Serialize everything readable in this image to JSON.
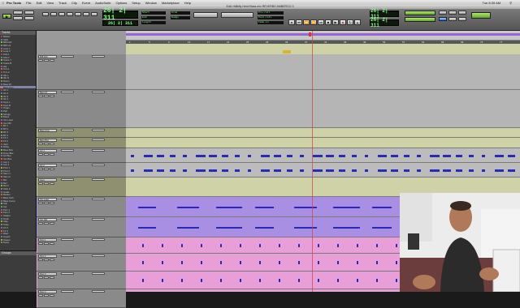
{
  "menubar": {
    "app": "Pro Tools",
    "items": [
      "File",
      "Edit",
      "View",
      "Track",
      "Clip",
      "Event",
      "AudioSuite",
      "Options",
      "Setup",
      "Window",
      "Marketplace",
      "Help"
    ],
    "clock": "Tue 8:39 AM"
  },
  "window": {
    "title": "Edit: Hillbilly Hemi Bass mix REVERBO AMBERGO 3"
  },
  "toolbar": {
    "main_counter": "26| 2| 311",
    "sub_counter": "26| 2| 311",
    "right_counter_a": "26| 2| 311",
    "right_counter_b": "26| 2| 311",
    "grid_label": "Grid",
    "nudge_label": "Nudge",
    "start_label": "Start",
    "end_label": "End",
    "length_label": "Length",
    "pre_roll": "Pre-roll",
    "post_roll": "Post-roll",
    "fade_in": "Fade-in"
  },
  "tracks_panel": {
    "header": "Tracks",
    "items": [
      "Master",
      "Click",
      "808 kick",
      "808 snr",
      "Loop 1",
      "Loop 2",
      "Kick 1",
      "Kick 2",
      "Snare T",
      "Snare B",
      "Hat",
      "Tom 1",
      "Tom 2",
      "OH L",
      "OH R",
      "Room",
      "Bass DI",
      "Bass Amp",
      "Gtr 1",
      "Gtr 2",
      "Gtr 3",
      "Gtr 4",
      "Keys L",
      "Keys R",
      "Organ",
      "Pad",
      "Strings",
      "Brass",
      "Vox Lead",
      "Vox Dbl",
      "BV 1",
      "BV 2",
      "BV 3",
      "BV 4",
      "FX 1",
      "FX 2",
      "Verb",
      "Delay",
      "Bass Bus",
      "Drum Bus",
      "Gtr Bus",
      "Vox Bus",
      "Aux 1",
      "Aux 2",
      "Print 1",
      "Print 2",
      "Stem 1",
      "Stem 2",
      "Mix",
      "Ref",
      "Ref 2",
      "Click 2",
      "Guide",
      "Marker",
      "Bass Verb",
      "Bass Comp",
      "Sub",
      "Arp",
      "Perc 1",
      "Perc 2",
      "Shaker",
      "Tamb",
      "Clap",
      "Snap",
      "FX 3",
      "FX 4",
      "Riser",
      "Impact",
      "Sweep",
      "Noise"
    ]
  },
  "groups_panel": {
    "header": "Groups"
  },
  "ruler": {
    "rows": [
      "Bars|Beats",
      "Tempo",
      "Meter",
      "Markers"
    ],
    "bars": [
      "1",
      "5",
      "9",
      "13",
      "17",
      "21",
      "25",
      "29",
      "33",
      "37",
      "41",
      "45",
      "49",
      "53",
      "57",
      "61",
      "65",
      "69",
      "73",
      "77"
    ]
  },
  "colors": {
    "gray_track": "#b5b5b5",
    "olive_track": "#cfd2a6",
    "blue_track": "#bcbcbc",
    "purple_track": "#a98fe3",
    "pink_track": "#e89ed6",
    "waveform": "#2a2bb5",
    "counter_green": "#8cff8c"
  },
  "track_rows": [
    {
      "name": "808 kick",
      "color": "gray"
    },
    {
      "name": "Bass DI",
      "color": "gray"
    },
    {
      "name": "Bass Amp",
      "color": "olive"
    },
    {
      "name": "Bass Bus",
      "color": "olive"
    },
    {
      "name": "Gtr 1",
      "color": "blue"
    },
    {
      "name": "Gtr 2",
      "color": "blue"
    },
    {
      "name": "Keys",
      "color": "olive"
    },
    {
      "name": "Vox Lead",
      "color": "purple"
    },
    {
      "name": "Vox Dbl",
      "color": "purple"
    },
    {
      "name": "Perc 1",
      "color": "pink"
    },
    {
      "name": "Perc 2",
      "color": "pink"
    },
    {
      "name": "Perc 3",
      "color": "pink"
    },
    {
      "name": "Perc 4",
      "color": "pink"
    }
  ]
}
